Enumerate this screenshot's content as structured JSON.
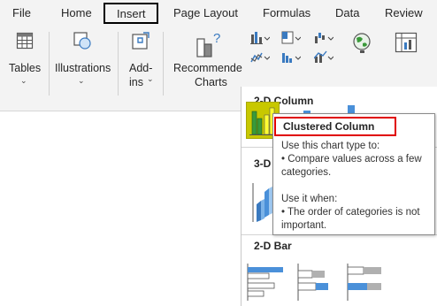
{
  "tabs": [
    {
      "label": "File"
    },
    {
      "label": "Home"
    },
    {
      "label": "Insert"
    },
    {
      "label": "Page Layout"
    },
    {
      "label": "Formulas"
    },
    {
      "label": "Data"
    },
    {
      "label": "Review"
    }
  ],
  "active_tab": "Insert",
  "ribbon": {
    "tables": {
      "label": "Tables",
      "icon": "table-icon"
    },
    "illustrations": {
      "label": "Illustrations",
      "icon": "shapes-icon"
    },
    "addins": {
      "label_line1": "Add-",
      "label_line2": "ins",
      "icon": "addins-icon"
    },
    "recommended": {
      "label_line1": "Recommende",
      "label_line2": "Charts",
      "icon": "recommended-charts-icon"
    }
  },
  "gallery": {
    "section_2d_column": "2-D Column",
    "section_3d": "3-D",
    "section_2d_bar": "2-D Bar"
  },
  "tooltip": {
    "title": "Clustered Column",
    "line1": "Use this chart type to:",
    "line2": "• Compare values across a few",
    "line3": "categories.",
    "line4": "Use it when:",
    "line5": "• The order of categories is not",
    "line6": "important."
  },
  "colors": {
    "selection_fill": "#c8c800",
    "tooltip_title_border": "#e00000",
    "bar_blue": "#4a90d9",
    "bar_green": "#3a9a3a"
  }
}
